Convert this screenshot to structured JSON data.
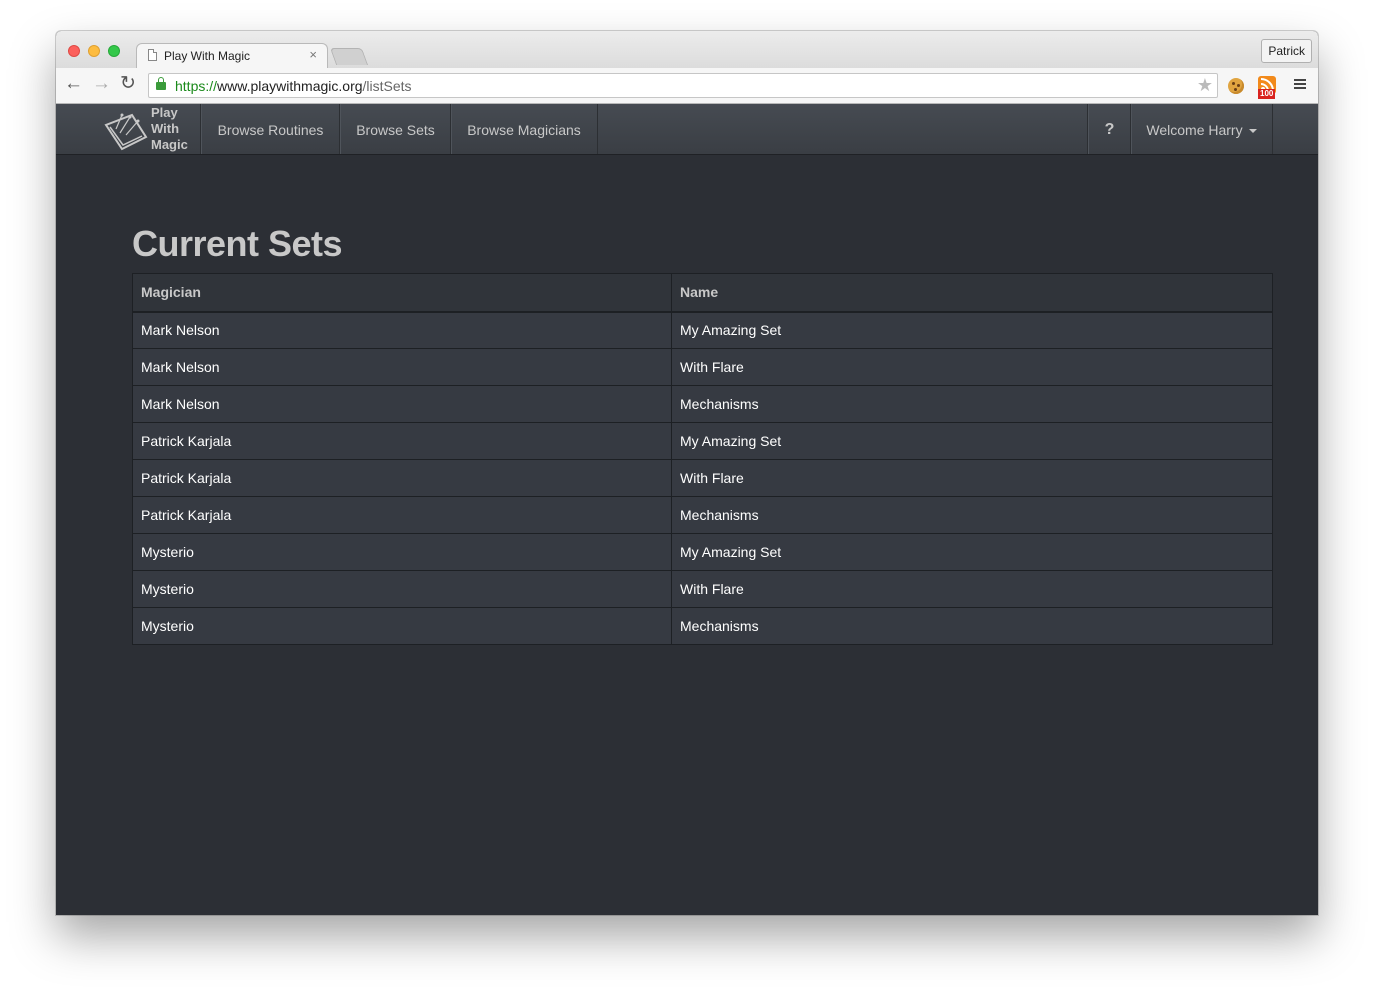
{
  "browser": {
    "tab_title": "Play With Magic",
    "tab_close": "×",
    "profile": "Patrick",
    "url_scheme": "https://",
    "url_host": "www.playwithmagic.org",
    "url_path": "/listSets",
    "rss_badge": "100",
    "nav_back": "←",
    "nav_forward": "→",
    "nav_reload": "↻",
    "star": "★"
  },
  "navbar": {
    "brand_line1": "Play",
    "brand_line2": "With",
    "brand_line3": "Magic",
    "items": [
      {
        "label": "Browse Routines"
      },
      {
        "label": "Browse Sets"
      },
      {
        "label": "Browse Magicians"
      }
    ],
    "help": "?",
    "user": "Welcome Harry"
  },
  "page": {
    "title": "Current Sets",
    "table": {
      "headers": [
        "Magician",
        "Name"
      ],
      "rows": [
        [
          "Mark Nelson",
          "My Amazing Set"
        ],
        [
          "Mark Nelson",
          "With Flare"
        ],
        [
          "Mark Nelson",
          "Mechanisms"
        ],
        [
          "Patrick Karjala",
          "My Amazing Set"
        ],
        [
          "Patrick Karjala",
          "With Flare"
        ],
        [
          "Patrick Karjala",
          "Mechanisms"
        ],
        [
          "Mysterio",
          "My Amazing Set"
        ],
        [
          "Mysterio",
          "With Flare"
        ],
        [
          "Mysterio",
          "Mechanisms"
        ]
      ]
    }
  },
  "colors": {
    "background": "#2c2f35",
    "navbar": "#3e4248",
    "text_muted": "#c8c8c8",
    "row": "#363a42"
  }
}
